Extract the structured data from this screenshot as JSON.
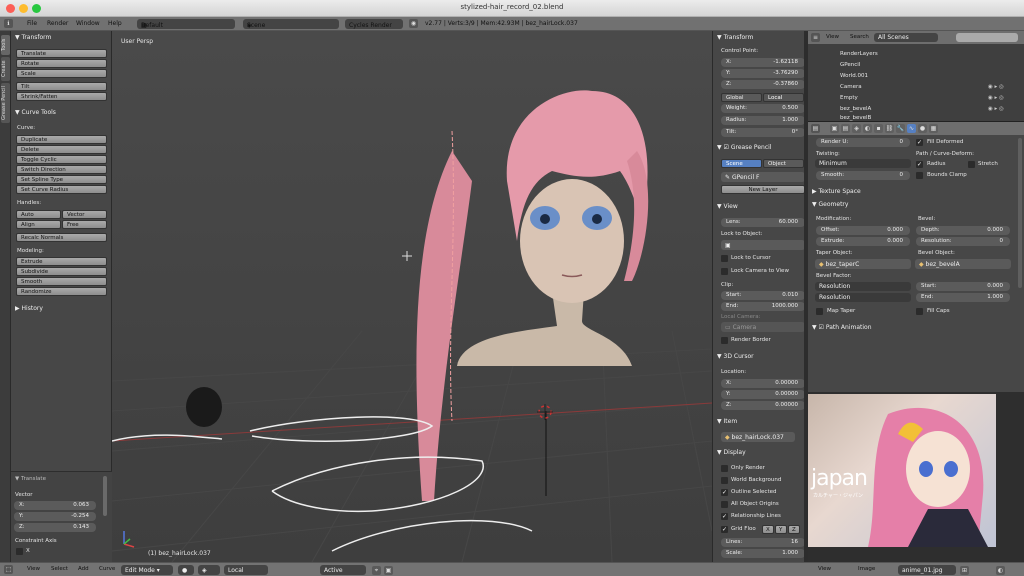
{
  "window": {
    "title": "stylized-hair_record_02.blend"
  },
  "menubar": {
    "menus": [
      "File",
      "Render",
      "Window",
      "Help"
    ],
    "screen": "Default",
    "scene": "Scene",
    "engine": "Cycles Render",
    "stats": "v2.77 | Verts:3/9 | Mem:42.93M | bez_hairLock.037"
  },
  "toolbar": {
    "tabs": [
      "Tools",
      "Create",
      "Grease Pencil"
    ],
    "transform_header": "Transform",
    "transform_buttons": [
      "Translate",
      "Rotate",
      "Scale",
      "Tilt",
      "Shrink/Fatten"
    ],
    "curve_tools_header": "Curve Tools",
    "curve_label": "Curve:",
    "curve_buttons": [
      "Duplicate",
      "Delete",
      "Toggle Cyclic",
      "Switch Direction",
      "Set Spline Type",
      "Set Curve Radius"
    ],
    "handles_label": "Handles:",
    "handles_row1": [
      "Auto",
      "Vector"
    ],
    "handles_row2": [
      "Align",
      "Free"
    ],
    "recalc": "Recalc Normals",
    "modeling_label": "Modeling:",
    "modeling_buttons": [
      "Extrude",
      "Subdivide",
      "Smooth",
      "Randomize"
    ],
    "history_header": "History",
    "op_header": "Translate",
    "vector_label": "Vector",
    "vector": [
      {
        "axis": "X:",
        "value": "0.063"
      },
      {
        "axis": "Y:",
        "value": "-0.254"
      },
      {
        "axis": "Z:",
        "value": "0.143"
      }
    ],
    "constraint_label": "Constraint Axis",
    "constraint_x": "X"
  },
  "viewport": {
    "label": "User Persp",
    "object": "(1) bez_hairLock.037"
  },
  "npanel": {
    "transform_header": "Transform",
    "control_point": "Control Point:",
    "cp": [
      {
        "axis": "X:",
        "value": "-1.62118"
      },
      {
        "axis": "Y:",
        "value": "-3.76290"
      },
      {
        "axis": "Z:",
        "value": "-0.37860"
      }
    ],
    "global": "Global",
    "local": "Local",
    "weight": {
      "label": "Weight:",
      "value": "0.500"
    },
    "radius": {
      "label": "Radius:",
      "value": "1.000"
    },
    "tilt": {
      "label": "Tilt:",
      "value": "0°"
    },
    "grease_header": "Grease Pencil",
    "gp_scene": "Scene",
    "gp_object": "Object",
    "gp_name": "GPencil",
    "gp_f": "F",
    "new_layer": "New Layer",
    "view_header": "View",
    "lens": {
      "label": "Lens:",
      "value": "60.000"
    },
    "lock_to_object": "Lock to Object:",
    "lock_cursor": "Lock to Cursor",
    "lock_camera": "Lock Camera to View",
    "clip": "Clip:",
    "clip_start": {
      "label": "Start:",
      "value": "0.010"
    },
    "clip_end": {
      "label": "End:",
      "value": "1000.000"
    },
    "local_camera": "Local Camera:",
    "camera": "Camera",
    "render_border": "Render Border",
    "cursor_header": "3D Cursor",
    "location": "Location:",
    "cursor": [
      {
        "axis": "X:",
        "value": "0.00000"
      },
      {
        "axis": "Y:",
        "value": "0.00000"
      },
      {
        "axis": "Z:",
        "value": "0.00000"
      }
    ],
    "item_header": "Item",
    "item_name": "bez_hairLock.037",
    "display_header": "Display",
    "display_options": [
      "Only Render",
      "World Background",
      "Outline Selected",
      "All Object Origins",
      "Relationship Lines"
    ],
    "display_checked": [
      false,
      false,
      true,
      false,
      true
    ],
    "grid_floor": "Grid Floo",
    "axes": [
      "X",
      "Y",
      "Z"
    ],
    "lines": {
      "label": "Lines:",
      "value": "16"
    },
    "scale": {
      "label": "Scale:",
      "value": "1.000"
    }
  },
  "outliner": {
    "menus": [
      "View",
      "Search"
    ],
    "filter": "All Scenes",
    "items": [
      "RenderLayers",
      "GPencil",
      "World.001",
      "Camera",
      "Empty",
      "bez_bevelA",
      "bez_bevelB"
    ]
  },
  "properties": {
    "render_u": "Render U:",
    "render_u_val": "0",
    "fill_deformed": "Fill Deformed",
    "twisting": "Twisting:",
    "twisting_val": "Minimum",
    "path_deform": "Path / Curve-Deform:",
    "radius": "Radius",
    "stretch": "Stretch",
    "smooth": {
      "label": "Smooth:",
      "value": "0"
    },
    "bounds_clamp": "Bounds Clamp",
    "texture_space": "Texture Space",
    "geometry": "Geometry",
    "modification": "Modification:",
    "bevel": "Bevel:",
    "offset": {
      "label": "Offset:",
      "value": "0.000"
    },
    "depth": {
      "label": "Depth:",
      "value": "0.000"
    },
    "extrude": {
      "label": "Extrude:",
      "value": "0.000"
    },
    "resolution": {
      "label": "Resolution:",
      "value": "0"
    },
    "taper_object": "Taper Object:",
    "taper_val": "bez_taperC",
    "bevel_object": "Bevel Object:",
    "bevel_val": "bez_bevelA",
    "bevel_factor": "Bevel Factor:",
    "res_mode1": "Resolution",
    "res_mode2": "Resolution",
    "bf_start": {
      "label": "Start:",
      "value": "0.000"
    },
    "bf_end": {
      "label": "End:",
      "value": "1.000"
    },
    "map_taper": "Map Taper",
    "fill_caps": "Fill Caps",
    "path_animation": "Path Animation"
  },
  "image_pane": {
    "logo": "japan",
    "subtitle": "カルチャー・ジャパン",
    "menus": [
      "View",
      "Image"
    ],
    "image_name": "anime_01.jpg"
  },
  "bottombar": {
    "menus": [
      "View",
      "Select",
      "Add",
      "Curve"
    ],
    "mode": "Edit Mode",
    "pivot": "Local",
    "proportional": "Active"
  }
}
